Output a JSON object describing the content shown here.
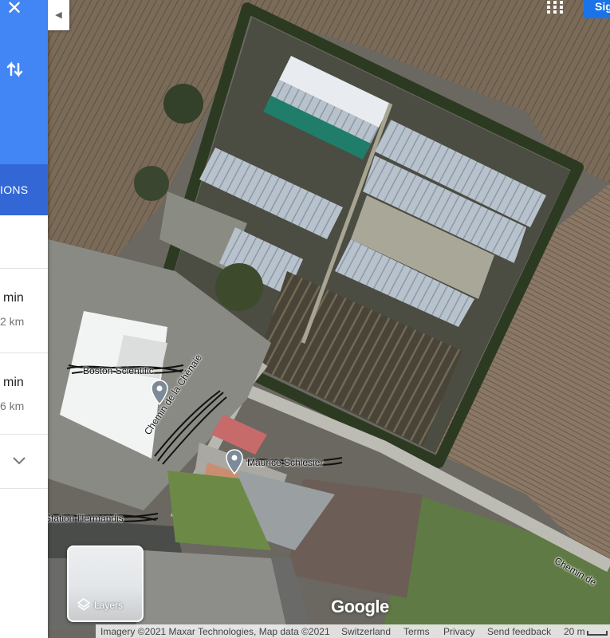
{
  "panel": {
    "close_icon": "close-icon",
    "swap_icon": "swap-directions-icon",
    "tab_label": "IONS",
    "routes": [
      {
        "duration": "min",
        "distance": "2 km"
      },
      {
        "duration": "min",
        "distance": "6 km"
      }
    ],
    "expand_icon": "chevron-down-icon"
  },
  "map": {
    "labels": [
      {
        "text": "Boston Scientific"
      },
      {
        "text": "Chemin de la Chênaie"
      },
      {
        "text": "Maurice Schlesier"
      },
      {
        "text": "Station Hermandis"
      },
      {
        "text": "Chemin de"
      }
    ]
  },
  "top_right": {
    "apps_icon": "apps-grid-icon",
    "signin_label": "Sig"
  },
  "layers": {
    "label": "Layers",
    "icon": "layers-icon"
  },
  "logo": "Google",
  "footer": {
    "imagery": "Imagery ©2021 Maxar Technologies, Map data ©2021",
    "country": "Switzerland",
    "terms": "Terms",
    "privacy": "Privacy",
    "feedback": "Send feedback",
    "scale": "20 m"
  },
  "colors": {
    "panel_blue": "#4285f4",
    "tab_blue": "#3367d6",
    "signin_blue": "#1a73e8"
  }
}
